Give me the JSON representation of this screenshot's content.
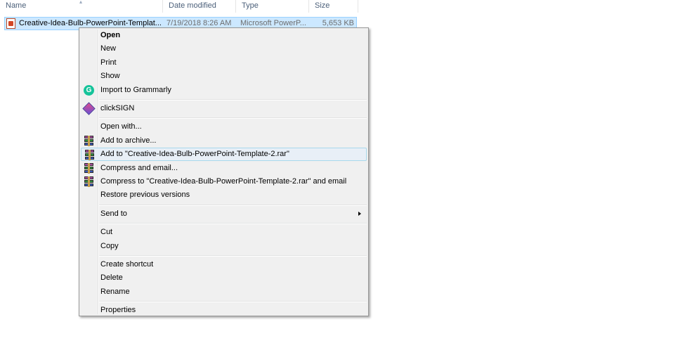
{
  "columns": {
    "name": "Name",
    "date_modified": "Date modified",
    "type": "Type",
    "size": "Size"
  },
  "file": {
    "icon": "powerpoint-file-icon",
    "name": "Creative-Idea-Bulb-PowerPoint-Templat...",
    "date_modified": "7/19/2018 8:26 AM",
    "type": "Microsoft PowerP...",
    "size": "5,653 KB"
  },
  "context_menu": {
    "groups": [
      [
        {
          "label": "Open",
          "bold": true
        },
        {
          "label": "New"
        },
        {
          "label": "Print"
        },
        {
          "label": "Show"
        },
        {
          "label": "Import to Grammarly",
          "icon": "grammarly-icon"
        }
      ],
      [
        {
          "label": "clickSIGN",
          "icon": "clicksign-icon"
        }
      ],
      [
        {
          "label": "Open with..."
        },
        {
          "label": "Add to archive...",
          "icon": "winrar-icon"
        },
        {
          "label": "Add to \"Creative-Idea-Bulb-PowerPoint-Template-2.rar\"",
          "icon": "winrar-icon",
          "hovered": true
        },
        {
          "label": "Compress and email...",
          "icon": "winrar-icon"
        },
        {
          "label": "Compress to \"Creative-Idea-Bulb-PowerPoint-Template-2.rar\" and email",
          "icon": "winrar-icon"
        },
        {
          "label": "Restore previous versions"
        }
      ],
      [
        {
          "label": "Send to",
          "submenu": true
        }
      ],
      [
        {
          "label": "Cut"
        },
        {
          "label": "Copy"
        }
      ],
      [
        {
          "label": "Create shortcut"
        },
        {
          "label": "Delete"
        },
        {
          "label": "Rename"
        }
      ],
      [
        {
          "label": "Properties"
        }
      ]
    ]
  },
  "colors": {
    "selection_bg": "#cce8ff",
    "menu_bg": "#f0f0f0",
    "hover_bg": "#e8eff7",
    "header_text": "#4c607a"
  }
}
